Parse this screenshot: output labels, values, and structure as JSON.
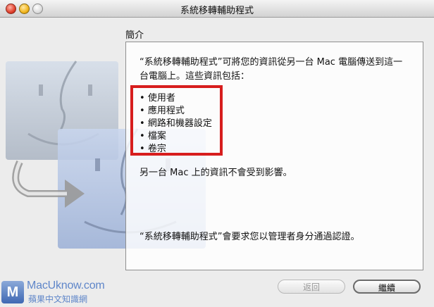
{
  "window": {
    "title": "系統移轉輔助程式"
  },
  "section": {
    "heading": "簡介"
  },
  "content": {
    "intro_line1": "“系統移轉輔助程式”可將您的資訊從另一台 Mac 電腦傳送到這一",
    "intro_line2": "台電腦上。這些資訊包括：",
    "items": [
      "使用者",
      "應用程式",
      "網路和機器設定",
      "檔案",
      "卷宗"
    ],
    "notice": "另一台 Mac 上的資訊不會受到影響。",
    "auth_note": "“系統移轉輔助程式”會要求您以管理者身分通過認證。"
  },
  "buttons": {
    "back": "返回",
    "continue": "繼續"
  },
  "watermark": {
    "logo_letter": "M",
    "site": "MacUknow.com",
    "subtitle": "蘋果中文知識網"
  },
  "colors": {
    "highlight": "#d71d1d",
    "watermark": "#5f86c9"
  },
  "icons": [
    "close-icon",
    "minimize-icon",
    "zoom-icon",
    "finder-face-icon",
    "arrow-icon"
  ]
}
